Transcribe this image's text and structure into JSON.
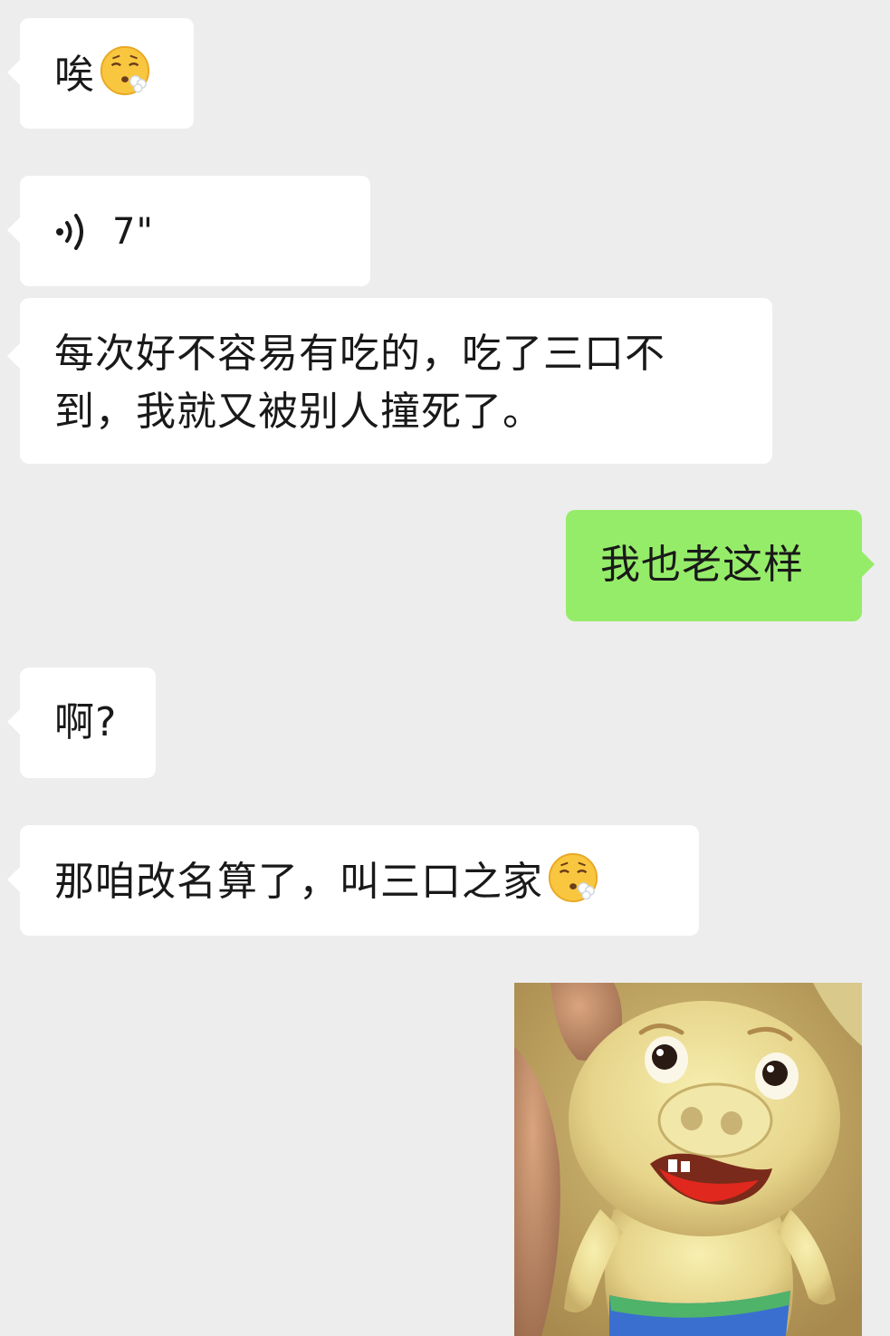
{
  "messages": [
    {
      "direction": "in",
      "type": "text",
      "text": "唉",
      "emoji": "exhaling-face-emoji"
    },
    {
      "direction": "in",
      "type": "voice",
      "duration": "7\""
    },
    {
      "direction": "in",
      "type": "text",
      "text": "每次好不容易有吃的，吃了三口不到，我就又被别人撞死了。"
    },
    {
      "direction": "out",
      "type": "text",
      "text": "我也老这样"
    },
    {
      "direction": "in",
      "type": "text",
      "text": "啊?"
    },
    {
      "direction": "in",
      "type": "text",
      "text": "那咱改名算了，叫三口之家",
      "emoji": "exhaling-face-emoji"
    },
    {
      "direction": "out",
      "type": "sticker",
      "sticker": "cartoon-pig-sticker"
    }
  ],
  "colors": {
    "background": "#ededed",
    "incoming_bubble": "#ffffff",
    "outgoing_bubble": "#95ec69",
    "text": "#191919"
  }
}
